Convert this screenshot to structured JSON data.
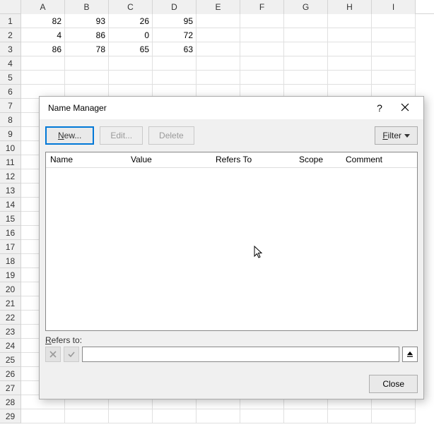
{
  "sheet": {
    "columns": [
      "A",
      "B",
      "C",
      "D",
      "E",
      "F",
      "G",
      "H",
      "I"
    ],
    "row_numbers": [
      1,
      2,
      3,
      4,
      5,
      6,
      7,
      8,
      9,
      10,
      11,
      12,
      13,
      14,
      15,
      16,
      17,
      18,
      19,
      20,
      21,
      22,
      23,
      24,
      25,
      26,
      27,
      28,
      29
    ],
    "cells": {
      "r1": {
        "A": "82",
        "B": "93",
        "C": "26",
        "D": "95"
      },
      "r2": {
        "A": "4",
        "B": "86",
        "C": "0",
        "D": "72"
      },
      "r3": {
        "A": "86",
        "B": "78",
        "C": "65",
        "D": "63"
      }
    }
  },
  "dialog": {
    "title": "Name Manager",
    "help_symbol": "?",
    "toolbar": {
      "new_prefix": "N",
      "new_rest": "ew...",
      "edit": "Edit...",
      "delete": "Delete",
      "filter_prefix": "F",
      "filter_rest": "ilter"
    },
    "columns": {
      "name": "Name",
      "value": "Value",
      "refers": "Refers To",
      "scope": "Scope",
      "comment": "Comment"
    },
    "refers_label_prefix": "R",
    "refers_label_rest": "efers to:",
    "refers_value": "",
    "close": "Close"
  }
}
